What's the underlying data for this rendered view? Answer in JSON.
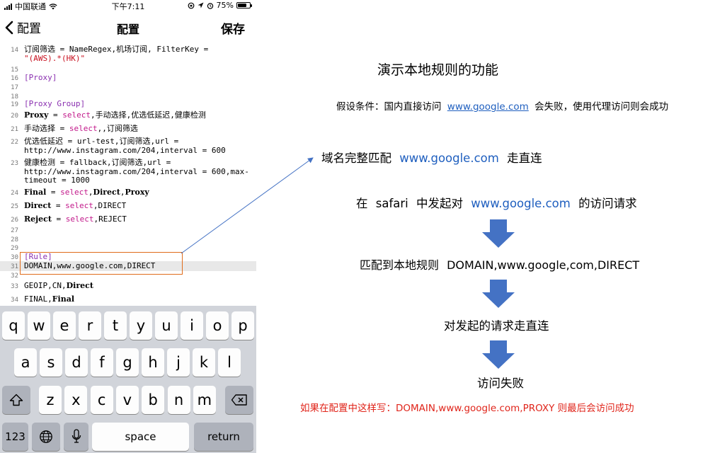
{
  "status_bar": {
    "carrier": "中国联通",
    "time": "下午7:11",
    "battery": "75%",
    "battery_level": 0.75
  },
  "nav": {
    "back_label": "配置",
    "title": "配置",
    "save_label": "保存"
  },
  "editor": {
    "lines": [
      {
        "n": "14",
        "segments": [
          {
            "t": "订阅筛选 = NameRegex,机场订阅, FilterKey = "
          }
        ]
      },
      {
        "n": "",
        "segments": [
          {
            "t": "\"(AWS).*(HK)\"",
            "style": "str"
          }
        ]
      },
      {
        "n": "15",
        "segments": []
      },
      {
        "n": "16",
        "segments": [
          {
            "t": "[Proxy]",
            "style": "sec"
          }
        ]
      },
      {
        "n": "17",
        "segments": []
      },
      {
        "n": "18",
        "segments": []
      },
      {
        "n": "19",
        "segments": [
          {
            "t": "[Proxy Group]",
            "style": "sec"
          }
        ]
      },
      {
        "n": "20",
        "segments": [
          {
            "t": "Proxy",
            "style": "bold"
          },
          {
            "t": " = "
          },
          {
            "t": "select",
            "style": "kw"
          },
          {
            "t": ",手动选择,优选低延迟,健康检测"
          }
        ]
      },
      {
        "n": "21",
        "segments": [
          {
            "t": "手动选择 = "
          },
          {
            "t": "select",
            "style": "kw"
          },
          {
            "t": ",,订阅筛选"
          }
        ]
      },
      {
        "n": "22",
        "segments": [
          {
            "t": "优选低延迟 = url-test,订阅筛选,url = http://www.instagram.com/204,interval = 600"
          }
        ]
      },
      {
        "n": "23",
        "segments": [
          {
            "t": "健康检测 = fallback,订阅筛选,url = http://www.instagram.com/204,interval = 600,max-timeout = 1000"
          }
        ]
      },
      {
        "n": "24",
        "segments": [
          {
            "t": "Final",
            "style": "bold"
          },
          {
            "t": " = "
          },
          {
            "t": "select",
            "style": "kw"
          },
          {
            "t": ","
          },
          {
            "t": "Direct",
            "style": "bold"
          },
          {
            "t": ","
          },
          {
            "t": "Proxy",
            "style": "bold"
          }
        ]
      },
      {
        "n": "25",
        "segments": [
          {
            "t": "Direct",
            "style": "bold"
          },
          {
            "t": " = "
          },
          {
            "t": "select",
            "style": "kw"
          },
          {
            "t": ",DIRECT"
          }
        ]
      },
      {
        "n": "26",
        "segments": [
          {
            "t": "Reject",
            "style": "bold"
          },
          {
            "t": " = "
          },
          {
            "t": "select",
            "style": "kw"
          },
          {
            "t": ",REJECT"
          }
        ]
      },
      {
        "n": "27",
        "segments": []
      },
      {
        "n": "28",
        "segments": []
      },
      {
        "n": "29",
        "segments": []
      },
      {
        "n": "30",
        "segments": [
          {
            "t": "[Rule]",
            "style": "sec"
          }
        ]
      },
      {
        "n": "31",
        "segments": [
          {
            "t": "DOMAIN,www.google.com,DIRECT"
          }
        ]
      },
      {
        "n": "32",
        "segments": []
      },
      {
        "n": "33",
        "segments": [
          {
            "t": "GEOIP,CN,"
          },
          {
            "t": "Direct",
            "style": "bold"
          }
        ]
      },
      {
        "n": "34",
        "segments": [
          {
            "t": "FINAL,"
          },
          {
            "t": "Final",
            "style": "bold"
          }
        ]
      }
    ]
  },
  "keyboard": {
    "row1": [
      "q",
      "w",
      "e",
      "r",
      "t",
      "y",
      "u",
      "i",
      "o",
      "p"
    ],
    "row2": [
      "a",
      "s",
      "d",
      "f",
      "g",
      "h",
      "j",
      "k",
      "l"
    ],
    "row3": [
      "z",
      "x",
      "c",
      "v",
      "b",
      "n",
      "m"
    ],
    "numbers_label": "123",
    "space_label": "space",
    "return_label": "return"
  },
  "diagram": {
    "title": "演示本地规则的功能",
    "assumption_prefix": "假设条件：国内直接访问",
    "assumption_link": "www.google.com",
    "assumption_suffix": "会失败，使用代理访问则会成功",
    "exact_prefix": "域名完整匹配",
    "exact_link": "www.google.com",
    "exact_suffix": "走直连",
    "step1_prefix": "在",
    "step1_safari": "safari",
    "step1_mid": "中发起对",
    "step1_link": "www.google.com",
    "step1_suffix": "的访问请求",
    "step2_prefix": "匹配到本地规则",
    "step2_rule": "DOMAIN,www.google,com,DIRECT",
    "step3": "对发起的请求走直连",
    "step4": "访问失败",
    "note": "如果在配置中这样写：DOMAIN,www.google.com,PROXY  则最后会访问成功",
    "colors": {
      "link": "#1f5fbf",
      "note": "#e0251b",
      "arrow": "#4472c4",
      "highlight": "#e06c1b"
    }
  }
}
